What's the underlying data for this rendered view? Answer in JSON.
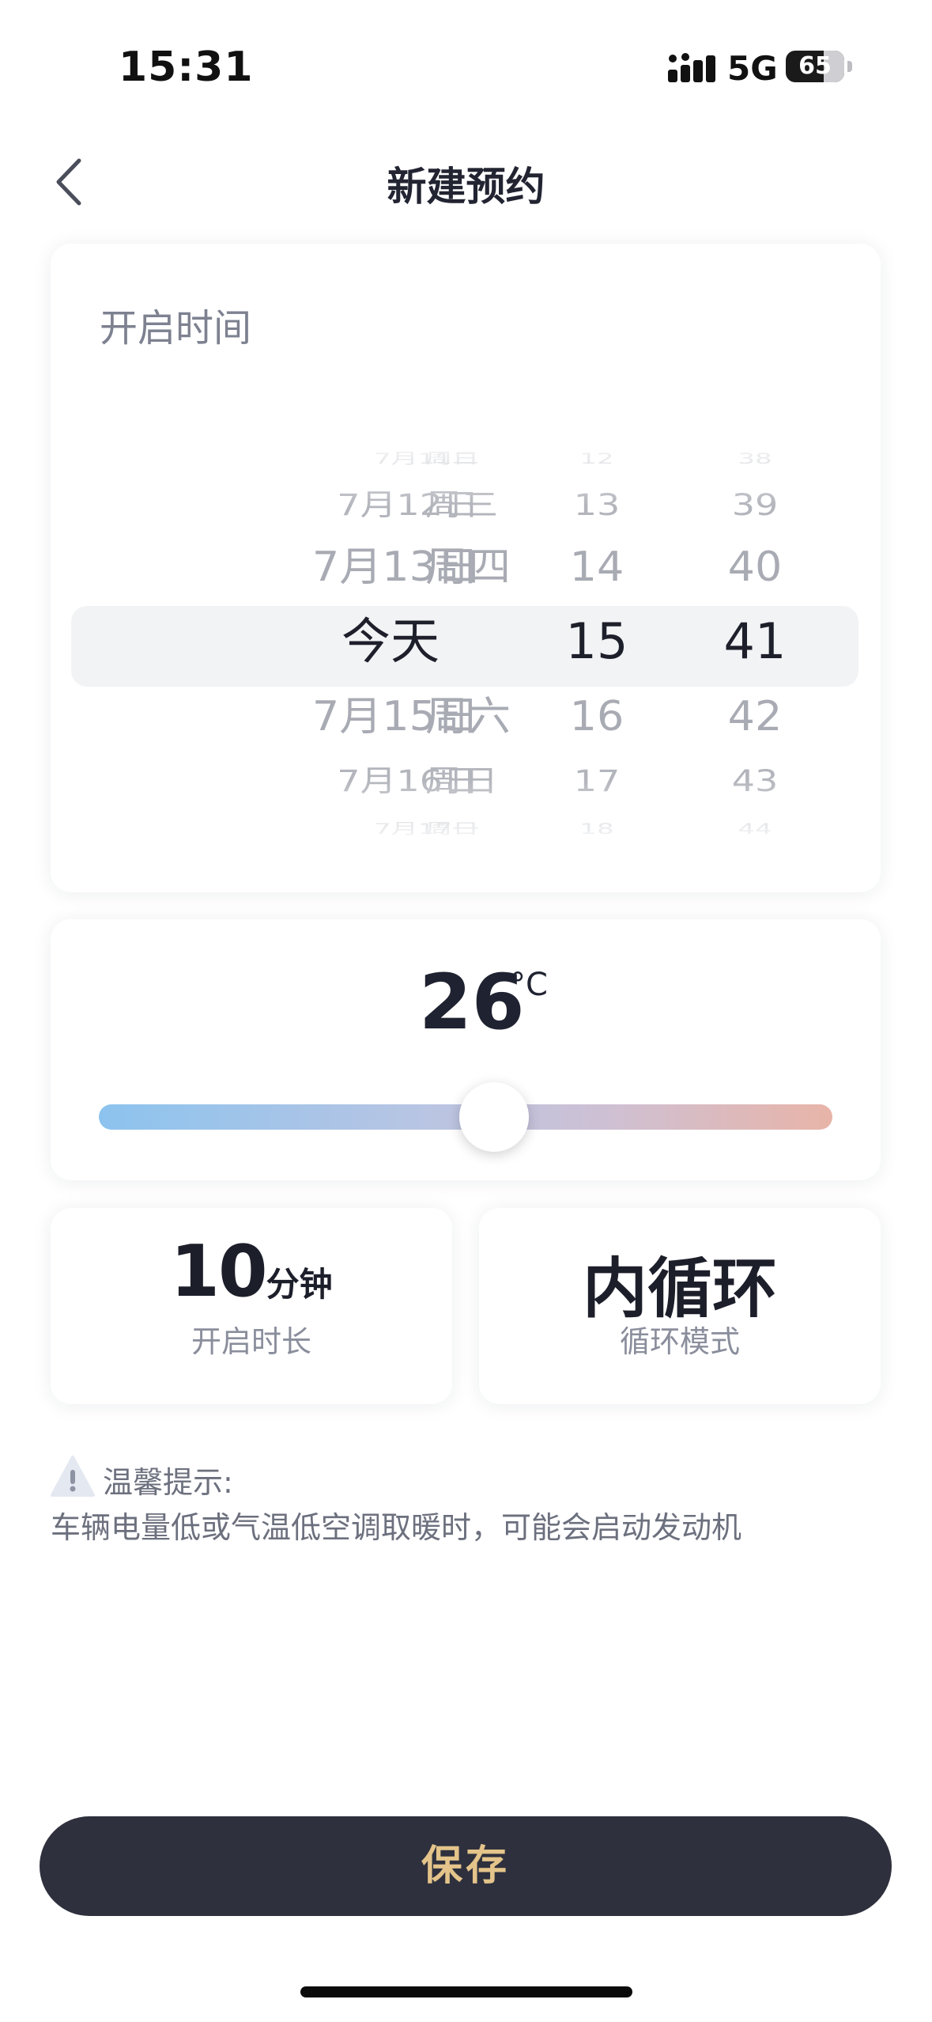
{
  "status_bar": {
    "time": "15:31",
    "network": "5G",
    "battery": "65",
    "battery_level": 0.65
  },
  "header": {
    "title": "新建预约"
  },
  "start_time": {
    "label": "开启时间",
    "picker_rows": [
      {
        "date": "7月11日",
        "weekday": "周二",
        "hour": "12",
        "minute": "38",
        "state": "edge"
      },
      {
        "date": "7月12日",
        "weekday": "周三",
        "hour": "13",
        "minute": "39",
        "state": "far"
      },
      {
        "date": "7月13日",
        "weekday": "周四",
        "hour": "14",
        "minute": "40",
        "state": "near"
      },
      {
        "date": "今天",
        "weekday": "",
        "hour": "15",
        "minute": "41",
        "state": "selected"
      },
      {
        "date": "7月15日",
        "weekday": "周六",
        "hour": "16",
        "minute": "42",
        "state": "near"
      },
      {
        "date": "7月16日",
        "weekday": "周日",
        "hour": "17",
        "minute": "43",
        "state": "far"
      },
      {
        "date": "7月17日",
        "weekday": "周一",
        "hour": "18",
        "minute": "44",
        "state": "edge"
      }
    ]
  },
  "temperature": {
    "value": "26",
    "unit": "°C",
    "slider_fraction": 0.55
  },
  "duration": {
    "value": "10",
    "unit": "分钟",
    "label": "开启时长"
  },
  "circulation": {
    "value": "内循环",
    "label": "循环模式"
  },
  "tip": {
    "title": "温馨提示:",
    "text": "车辆电量低或气温低空调取暖时，可能会启动发动机"
  },
  "save_button": {
    "label": "保存"
  },
  "colors": {
    "button_bg": "#2e303d",
    "button_text": "#e4c48a",
    "slider_cool": "#8cc3ee",
    "slider_warm": "#e8b4a8",
    "muted_text": "#8a8e9c"
  }
}
